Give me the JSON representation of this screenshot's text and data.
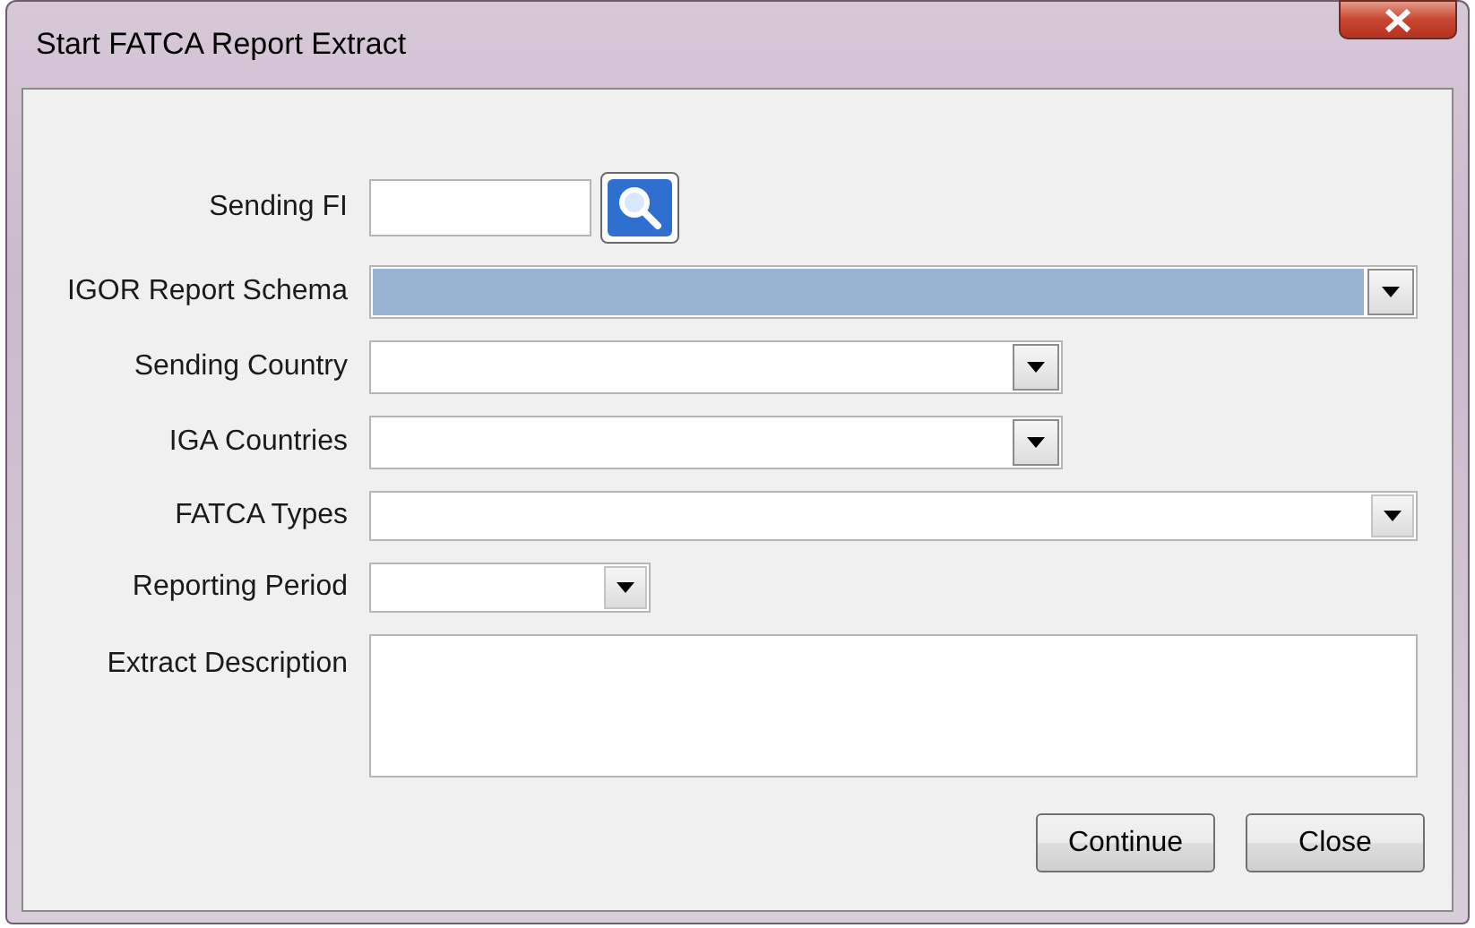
{
  "window": {
    "title": "Start FATCA Report Extract"
  },
  "fields": [
    {
      "label": "Sending FI",
      "kind": "lookup"
    },
    {
      "label": "IGOR Report Schema",
      "kind": "combo",
      "focused": true
    },
    {
      "label": "Sending Country",
      "kind": "combo",
      "focused": false
    },
    {
      "label": "IGA Countries",
      "kind": "combo",
      "focused": false
    },
    {
      "label": "FATCA Types",
      "kind": "combo-flat",
      "focused": false
    },
    {
      "label": "Reporting Period",
      "kind": "combo-flat",
      "focused": false
    },
    {
      "label": "Extract Description",
      "kind": "memo"
    }
  ],
  "buttons": [
    "Continue",
    "Close"
  ]
}
